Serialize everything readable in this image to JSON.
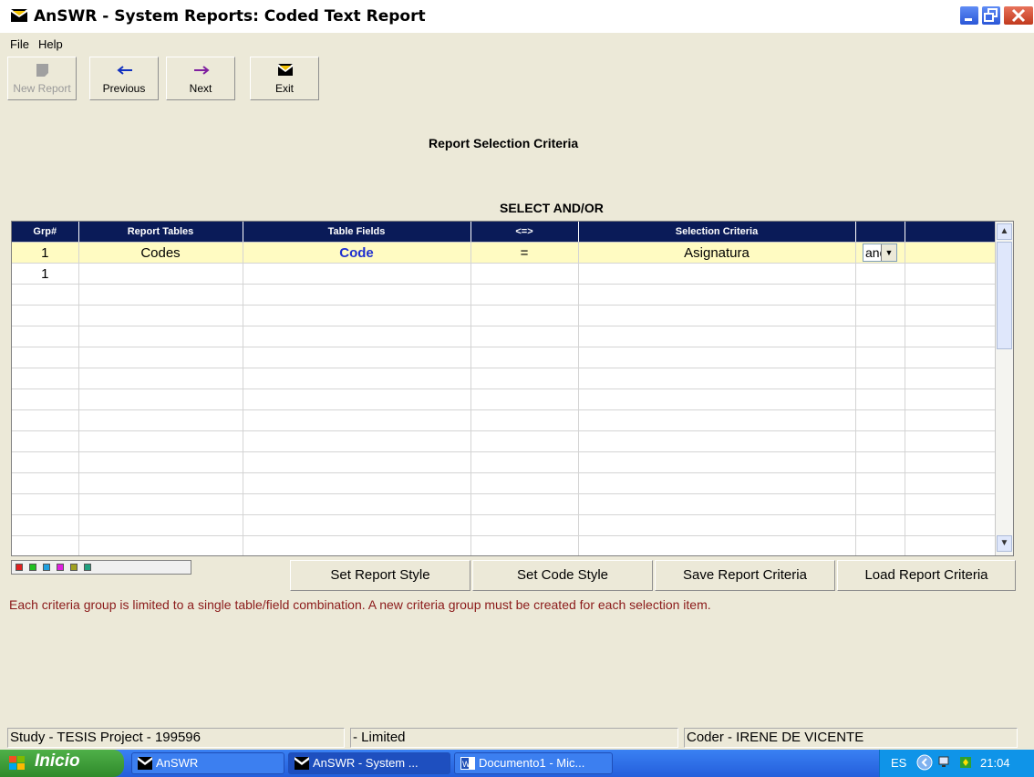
{
  "window": {
    "title": "AnSWR - System Reports:  Coded Text Report"
  },
  "menu": {
    "file": "File",
    "help": "Help"
  },
  "toolbar": {
    "new_report": "New Report",
    "previous": "Previous",
    "next": "Next",
    "exit": "Exit"
  },
  "headings": {
    "criteria": "Report Selection Criteria",
    "select": "SELECT AND/OR"
  },
  "grid": {
    "columns": [
      "Grp#",
      "Report Tables",
      "Table Fields",
      "<=>",
      "Selection Criteria",
      "",
      ""
    ],
    "row1": {
      "grp": "1",
      "table": "Codes",
      "field": "Code",
      "op": "=",
      "criteria": "Asignatura",
      "andor": "and"
    },
    "row2": {
      "grp": "1"
    }
  },
  "colors": {
    "header_bg": "#0a1b58",
    "highlight_row": "#fffbc2",
    "field_text": "#1f2fd0",
    "note_text": "#8b1a1a"
  },
  "buttons": {
    "set_report_style": "Set Report Style",
    "set_code_style": "Set Code Style",
    "save_report_criteria": "Save Report Criteria",
    "load_report_criteria": "Load Report Criteria"
  },
  "note": "Each criteria group is limited to a single table/field combination. A new criteria group must be created for each selection item.",
  "status": {
    "study": "Study - TESIS   Project - 199596",
    "limited": "- Limited",
    "coder": "Coder - IRENE DE VICENTE"
  },
  "taskbar": {
    "start": "Inicio",
    "tasks": [
      "AnSWR",
      "AnSWR - System ...",
      "Documento1 - Mic..."
    ],
    "lang": "ES",
    "clock": "21:04"
  }
}
